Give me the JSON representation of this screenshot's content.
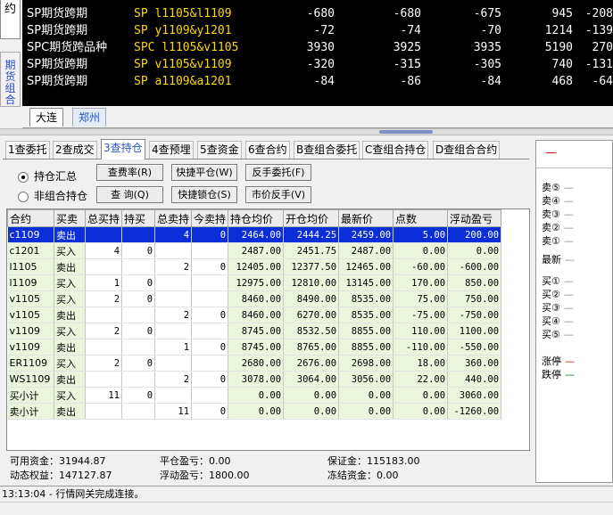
{
  "left_tabs": {
    "top_label": "约",
    "combo_label": "期货组合"
  },
  "quotes": [
    {
      "name": "SP期货跨期",
      "code": "SP l1105&l1109",
      "v1": "-680",
      "v2": "-680",
      "v3": "-675",
      "v4": "945",
      "v5": "-208"
    },
    {
      "name": "SP期货跨期",
      "code": "SP y1109&y1201",
      "v1": "-72",
      "v2": "-74",
      "v3": "-70",
      "v4": "1214",
      "v5": "-139"
    },
    {
      "name": "SPC期货跨品种",
      "code": "SPC l1105&v1105",
      "v1": "3930",
      "v2": "3925",
      "v3": "3935",
      "v4": "5190",
      "v5": "270"
    },
    {
      "name": "SP期货跨期",
      "code": "SP v1105&v1109",
      "v1": "-320",
      "v2": "-315",
      "v3": "-305",
      "v4": "740",
      "v5": "-131"
    },
    {
      "name": "SP期货跨期",
      "code": "SP a1109&a1201",
      "v1": "-84",
      "v2": "-86",
      "v3": "-84",
      "v4": "468",
      "v5": "-64"
    }
  ],
  "exchange_tabs": [
    "大连",
    "郑州"
  ],
  "func_tabs": [
    "1查委托",
    "2查成交",
    "3查持仓",
    "4查预埋",
    "5查资金",
    "6查合约",
    "B查组合委托",
    "C查组合持仓",
    "D查组合合约"
  ],
  "radios": {
    "summary": "持仓汇总",
    "non_combo": "非组合持仓"
  },
  "buttons": {
    "fee_rate": "查费率(R)",
    "quick_close": "快捷平仓(W)",
    "reverse_order": "反手委托(F)",
    "query": "查 询(Q)",
    "quick_lock": "快捷锁仓(S)",
    "market_reverse": "市价反手(V)"
  },
  "table": {
    "headers": [
      "合约",
      "买卖",
      "总买持",
      "持买",
      "总卖持",
      "今卖持",
      "持仓均价",
      "开仓均价",
      "最新价",
      "点数",
      "浮动盈亏"
    ],
    "rows": [
      [
        "c1109",
        "卖出",
        "",
        "",
        "4",
        "0",
        "2464.00",
        "2444.25",
        "2459.00",
        "5.00",
        "200.00"
      ],
      [
        "c1201",
        "买入",
        "4",
        "0",
        "",
        "",
        "2487.00",
        "2451.75",
        "2487.00",
        "0.00",
        "0.00"
      ],
      [
        "l1105",
        "卖出",
        "",
        "",
        "2",
        "0",
        "12405.00",
        "12377.50",
        "12465.00",
        "-60.00",
        "-600.00"
      ],
      [
        "l1109",
        "买入",
        "1",
        "0",
        "",
        "",
        "12975.00",
        "12810.00",
        "13145.00",
        "170.00",
        "850.00"
      ],
      [
        "v1105",
        "买入",
        "2",
        "0",
        "",
        "",
        "8460.00",
        "8490.00",
        "8535.00",
        "75.00",
        "750.00"
      ],
      [
        "v1105",
        "卖出",
        "",
        "",
        "2",
        "0",
        "8460.00",
        "6270.00",
        "8535.00",
        "-75.00",
        "-750.00"
      ],
      [
        "v1109",
        "买入",
        "2",
        "0",
        "",
        "",
        "8745.00",
        "8532.50",
        "8855.00",
        "110.00",
        "1100.00"
      ],
      [
        "v1109",
        "卖出",
        "",
        "",
        "1",
        "0",
        "8745.00",
        "8765.00",
        "8855.00",
        "-110.00",
        "-550.00"
      ],
      [
        "ER1109",
        "买入",
        "2",
        "0",
        "",
        "",
        "2680.00",
        "2676.00",
        "2698.00",
        "18.00",
        "360.00"
      ],
      [
        "WS1109",
        "卖出",
        "",
        "",
        "2",
        "0",
        "3078.00",
        "3064.00",
        "3056.00",
        "22.00",
        "440.00"
      ],
      [
        "买小计",
        "买入",
        "11",
        "0",
        "",
        "",
        "0.00",
        "0.00",
        "0.00",
        "0.00",
        "3060.00"
      ],
      [
        "卖小计",
        "卖出",
        "",
        "",
        "11",
        "0",
        "0.00",
        "0.00",
        "0.00",
        "0.00",
        "-1260.00"
      ]
    ]
  },
  "summary": {
    "available": "可用资金：31944.87",
    "close_pl": "平仓盈亏：0.00",
    "margin": "保证金：115183.00",
    "dynamic": "动态权益：147127.87",
    "float_pl": "浮动盈亏：1800.00",
    "frozen": "冻结资金：0.00"
  },
  "status": "13:13:04 - 行情网关完成连接。",
  "right_panel": {
    "header": "—",
    "sell": [
      "卖⑤",
      "卖④",
      "卖③",
      "卖②",
      "卖①"
    ],
    "latest": "最新",
    "buy": [
      "买①",
      "买②",
      "买③",
      "买④",
      "买⑤"
    ],
    "limit_up": "涨停",
    "limit_down": "跌停",
    "dash": "—",
    "colors": {
      "up": "#d00000",
      "down": "#008000"
    }
  }
}
